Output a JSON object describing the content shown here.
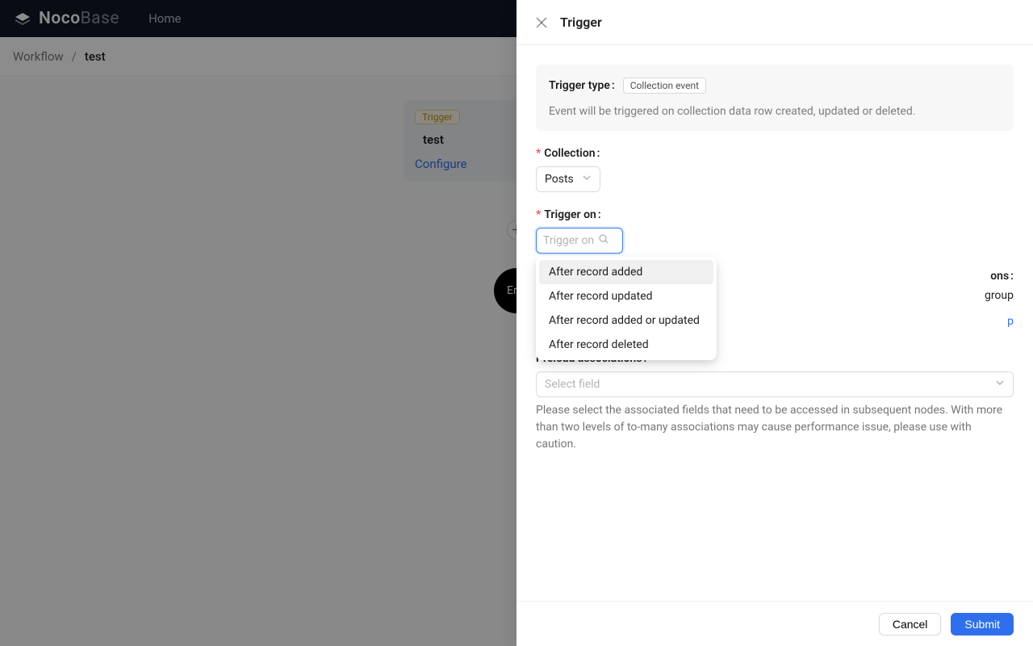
{
  "topbar": {
    "brand_bold": "Noco",
    "brand_light": "Base",
    "home": "Home"
  },
  "breadcrumb": {
    "workflow": "Workflow",
    "current": "test"
  },
  "canvas": {
    "trigger_tag": "Trigger",
    "trigger_title": "test",
    "configure": "Configure",
    "end": "End"
  },
  "drawer": {
    "title": "Trigger",
    "trigger_type_label": "Trigger type",
    "trigger_type_value": "Collection event",
    "trigger_type_desc": "Event will be triggered on collection data row created, updated or deleted.",
    "collection_label": "Collection",
    "collection_value": "Posts",
    "trigger_on_label": "Trigger on",
    "trigger_on_placeholder": "Trigger on",
    "trigger_on_options": [
      "After record added",
      "After record updated",
      "After record added or updated",
      "After record deleted"
    ],
    "conditions_suffix": "ons",
    "conditions_hidden_word": "group",
    "add_group_suffix": "p",
    "preload_label": "Preload associations",
    "preload_placeholder": "Select field",
    "preload_helper": "Please select the associated fields that need to be accessed in subsequent nodes. With more than two levels of to-many associations may cause performance issue, please use with caution.",
    "cancel": "Cancel",
    "submit": "Submit"
  }
}
